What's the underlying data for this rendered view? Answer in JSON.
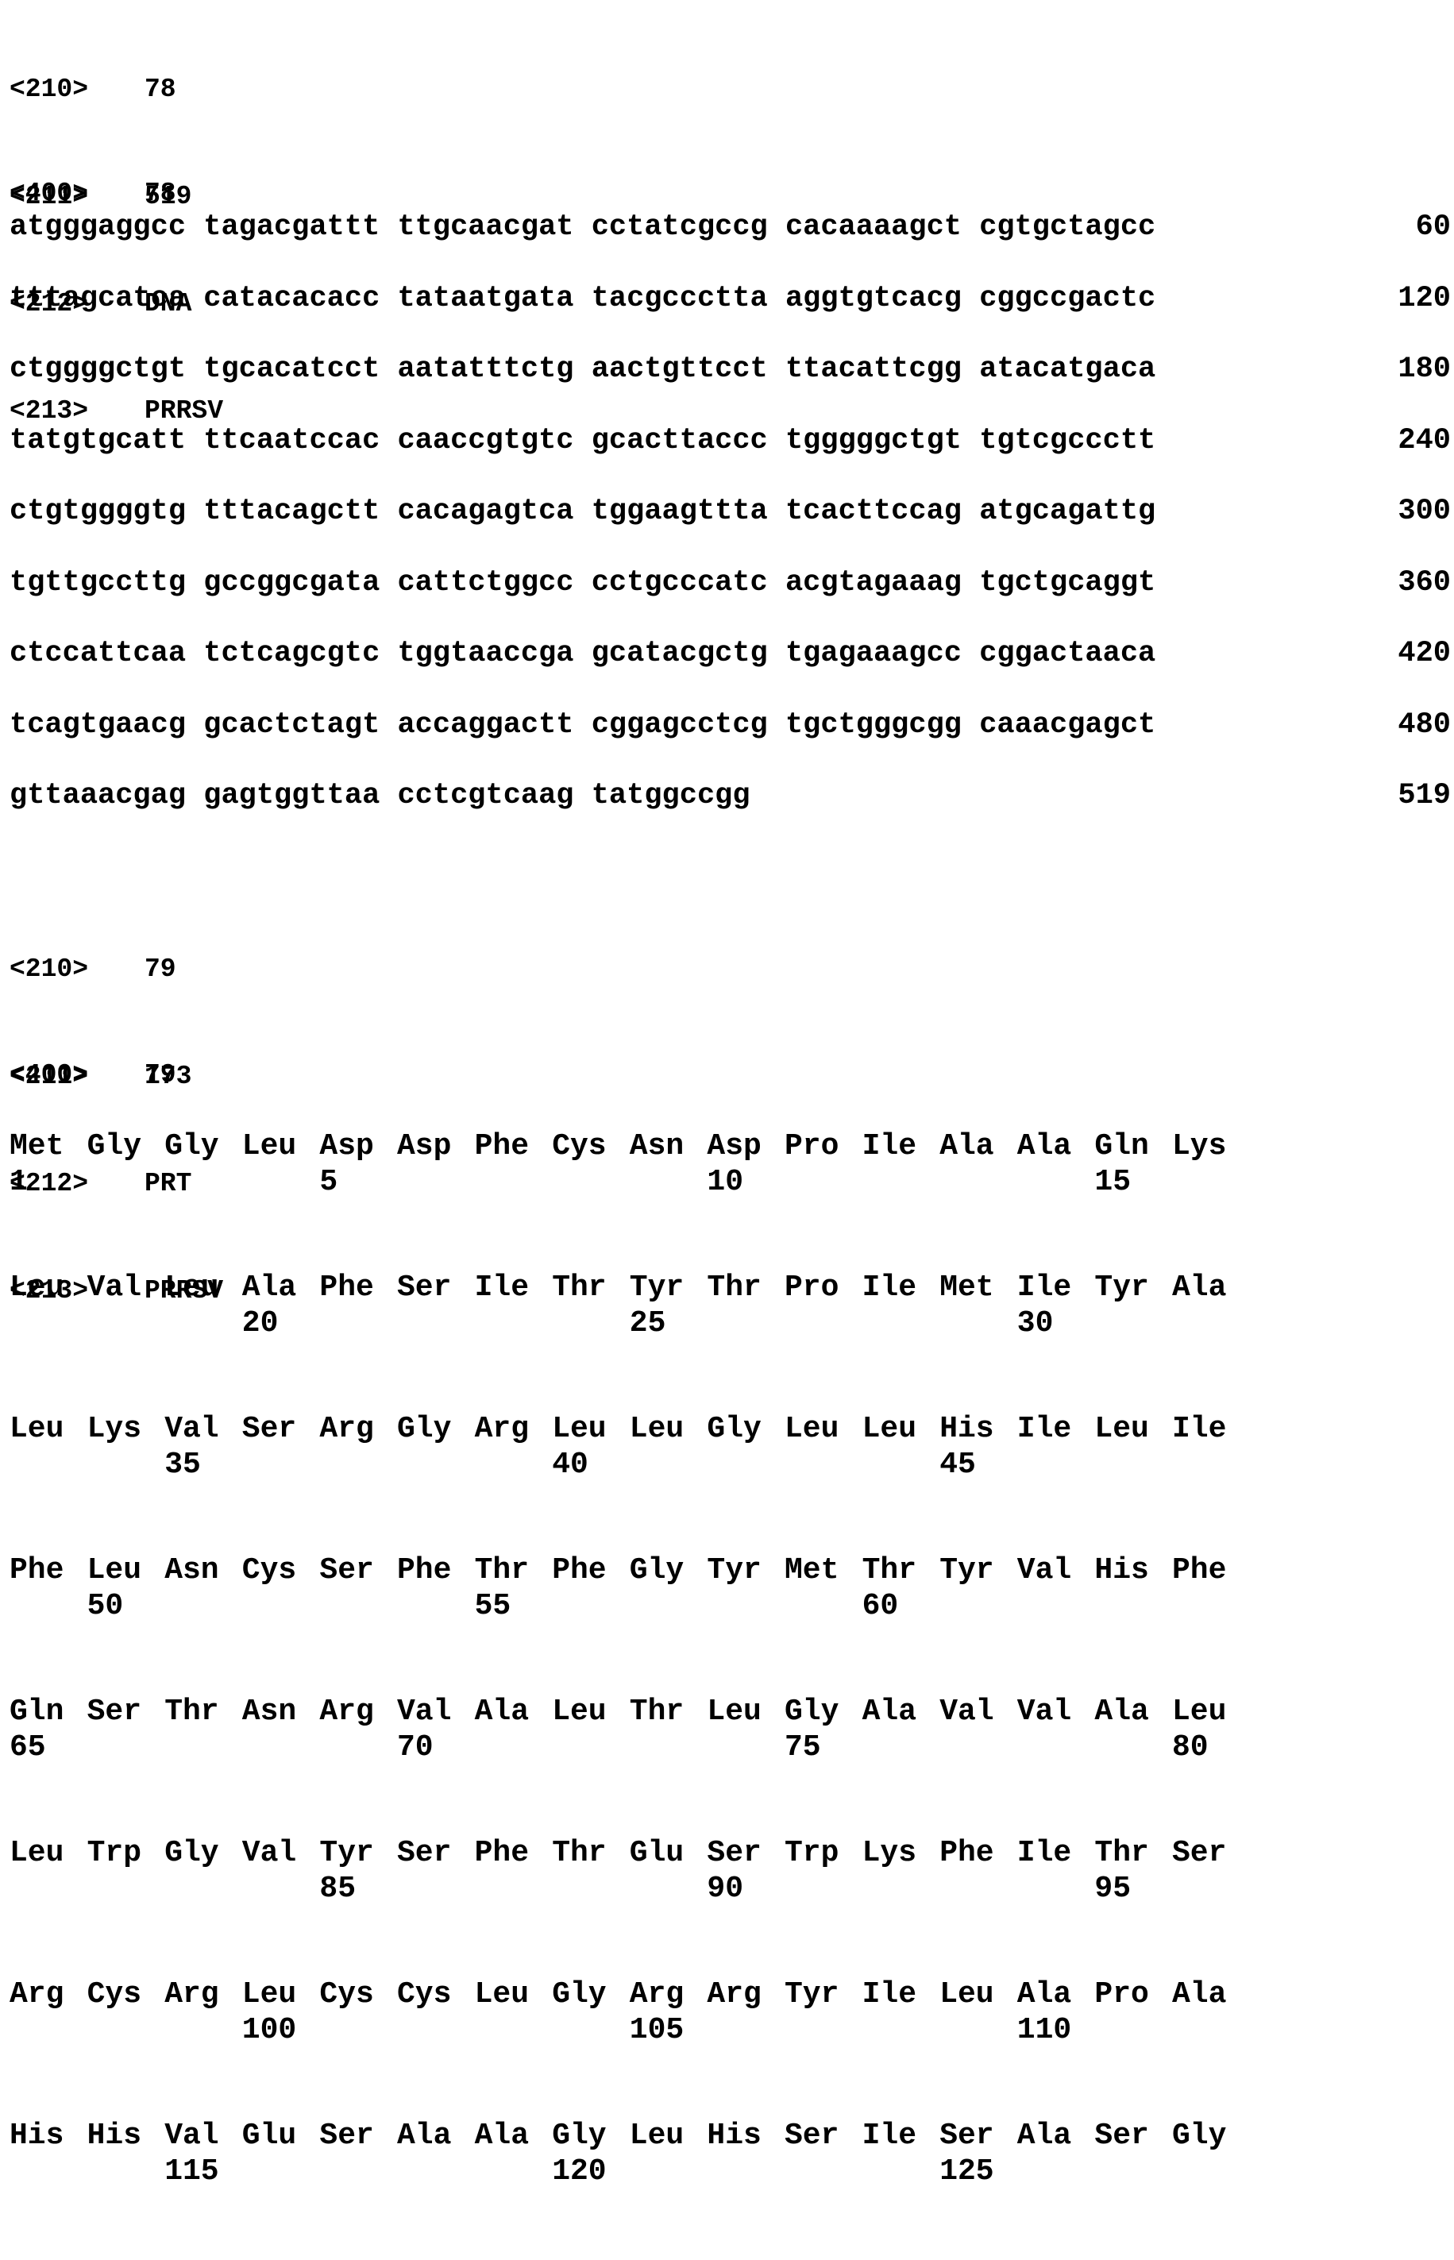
{
  "seq78": {
    "header": [
      {
        "tag": "<210>",
        "value": "78"
      },
      {
        "tag": "<211>",
        "value": "519"
      },
      {
        "tag": "<212>",
        "value": "DNA"
      },
      {
        "tag": "<213>",
        "value": "PRRSV"
      }
    ],
    "seq_tag": {
      "tag": "<400>",
      "value": "78"
    },
    "rows": [
      {
        "seq": "atgggaggcc tagacgattt ttgcaacgat cctatcgccg cacaaaagct cgtgctagcc",
        "num": "60"
      },
      {
        "seq": "tttagcatca catacacacc tataatgata tacgccctta aggtgtcacg cggccgactc",
        "num": "120"
      },
      {
        "seq": "ctggggctgt tgcacatcct aatatttctg aactgttcct ttacattcgg atacatgaca",
        "num": "180"
      },
      {
        "seq": "tatgtgcatt ttcaatccac caaccgtgtc gcacttaccc tgggggctgt tgtcgccctt",
        "num": "240"
      },
      {
        "seq": "ctgtggggtg tttacagctt cacagagtca tggaagttta tcacttccag atgcagattg",
        "num": "300"
      },
      {
        "seq": "tgttgccttg gccggcgata cattctggcc cctgcccatc acgtagaaag tgctgcaggt",
        "num": "360"
      },
      {
        "seq": "ctccattcaa tctcagcgtc tggtaaccga gcatacgctg tgagaaagcc cggactaaca",
        "num": "420"
      },
      {
        "seq": "tcagtgaacg gcactctagt accaggactt cggagcctcg tgctgggcgg caaacgagct",
        "num": "480"
      },
      {
        "seq": "gttaaacgag gagtggttaa cctcgtcaag tatggccgg",
        "num": "519"
      }
    ]
  },
  "seq79": {
    "header": [
      {
        "tag": "<210>",
        "value": "79"
      },
      {
        "tag": "<211>",
        "value": "173"
      },
      {
        "tag": "<212>",
        "value": "PRT"
      },
      {
        "tag": "<213>",
        "value": "PRRSV"
      }
    ],
    "seq_tag": {
      "tag": "<400>",
      "value": "79"
    },
    "groups": [
      {
        "residues": [
          "Met",
          "Gly",
          "Gly",
          "Leu",
          "Asp",
          "Asp",
          "Phe",
          "Cys",
          "Asn",
          "Asp",
          "Pro",
          "Ile",
          "Ala",
          "Ala",
          "Gln",
          "Lys"
        ],
        "numbers": [
          {
            "col": 0,
            "text": "1"
          },
          {
            "col": 4,
            "text": "5"
          },
          {
            "col": 9,
            "text": "10"
          },
          {
            "col": 14,
            "text": "15"
          }
        ]
      },
      {
        "residues": [
          "Leu",
          "Val",
          "Leu",
          "Ala",
          "Phe",
          "Ser",
          "Ile",
          "Thr",
          "Tyr",
          "Thr",
          "Pro",
          "Ile",
          "Met",
          "Ile",
          "Tyr",
          "Ala"
        ],
        "numbers": [
          {
            "col": 3,
            "text": "20"
          },
          {
            "col": 8,
            "text": "25"
          },
          {
            "col": 13,
            "text": "30"
          }
        ]
      },
      {
        "residues": [
          "Leu",
          "Lys",
          "Val",
          "Ser",
          "Arg",
          "Gly",
          "Arg",
          "Leu",
          "Leu",
          "Gly",
          "Leu",
          "Leu",
          "His",
          "Ile",
          "Leu",
          "Ile"
        ],
        "numbers": [
          {
            "col": 2,
            "text": "35"
          },
          {
            "col": 7,
            "text": "40"
          },
          {
            "col": 12,
            "text": "45"
          }
        ]
      },
      {
        "residues": [
          "Phe",
          "Leu",
          "Asn",
          "Cys",
          "Ser",
          "Phe",
          "Thr",
          "Phe",
          "Gly",
          "Tyr",
          "Met",
          "Thr",
          "Tyr",
          "Val",
          "His",
          "Phe"
        ],
        "numbers": [
          {
            "col": 1,
            "text": "50"
          },
          {
            "col": 6,
            "text": "55"
          },
          {
            "col": 11,
            "text": "60"
          }
        ]
      },
      {
        "residues": [
          "Gln",
          "Ser",
          "Thr",
          "Asn",
          "Arg",
          "Val",
          "Ala",
          "Leu",
          "Thr",
          "Leu",
          "Gly",
          "Ala",
          "Val",
          "Val",
          "Ala",
          "Leu"
        ],
        "numbers": [
          {
            "col": 0,
            "text": "65"
          },
          {
            "col": 5,
            "text": "70"
          },
          {
            "col": 10,
            "text": "75"
          },
          {
            "col": 15,
            "text": "80"
          }
        ]
      },
      {
        "residues": [
          "Leu",
          "Trp",
          "Gly",
          "Val",
          "Tyr",
          "Ser",
          "Phe",
          "Thr",
          "Glu",
          "Ser",
          "Trp",
          "Lys",
          "Phe",
          "Ile",
          "Thr",
          "Ser"
        ],
        "numbers": [
          {
            "col": 4,
            "text": "85"
          },
          {
            "col": 9,
            "text": "90"
          },
          {
            "col": 14,
            "text": "95"
          }
        ]
      },
      {
        "residues": [
          "Arg",
          "Cys",
          "Arg",
          "Leu",
          "Cys",
          "Cys",
          "Leu",
          "Gly",
          "Arg",
          "Arg",
          "Tyr",
          "Ile",
          "Leu",
          "Ala",
          "Pro",
          "Ala"
        ],
        "numbers": [
          {
            "col": 3,
            "text": "100"
          },
          {
            "col": 8,
            "text": "105"
          },
          {
            "col": 13,
            "text": "110"
          }
        ]
      },
      {
        "residues": [
          "His",
          "His",
          "Val",
          "Glu",
          "Ser",
          "Ala",
          "Ala",
          "Gly",
          "Leu",
          "His",
          "Ser",
          "Ile",
          "Ser",
          "Ala",
          "Ser",
          "Gly"
        ],
        "numbers": [
          {
            "col": 2,
            "text": "115"
          },
          {
            "col": 7,
            "text": "120"
          },
          {
            "col": 12,
            "text": "125"
          }
        ]
      }
    ]
  }
}
